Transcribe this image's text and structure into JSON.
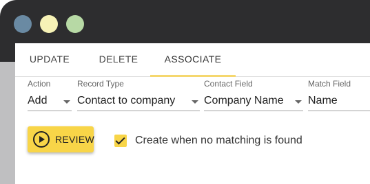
{
  "window": {
    "traffic_lights": {
      "close_color": "#6a8aa3",
      "minimize_color": "#f6f2b6",
      "maximize_color": "#b7d9a5"
    }
  },
  "tabs": [
    {
      "label": "UPDATE"
    },
    {
      "label": "DELETE"
    },
    {
      "label": "ASSOCIATE"
    }
  ],
  "active_tab": "ASSOCIATE",
  "accent_color": "#f8d548",
  "fields": {
    "action": {
      "label": "Action",
      "value": "Add"
    },
    "record_type": {
      "label": "Record Type",
      "value": "Contact to company"
    },
    "contact_field": {
      "label": "Contact Field",
      "value": "Company Name"
    },
    "match_field": {
      "label": "Match Field",
      "value": "Name"
    }
  },
  "review_button": {
    "label": "REVIEW",
    "icon": "play-circle-icon"
  },
  "create_checkbox": {
    "checked": true,
    "label": "Create when no matching is found"
  }
}
